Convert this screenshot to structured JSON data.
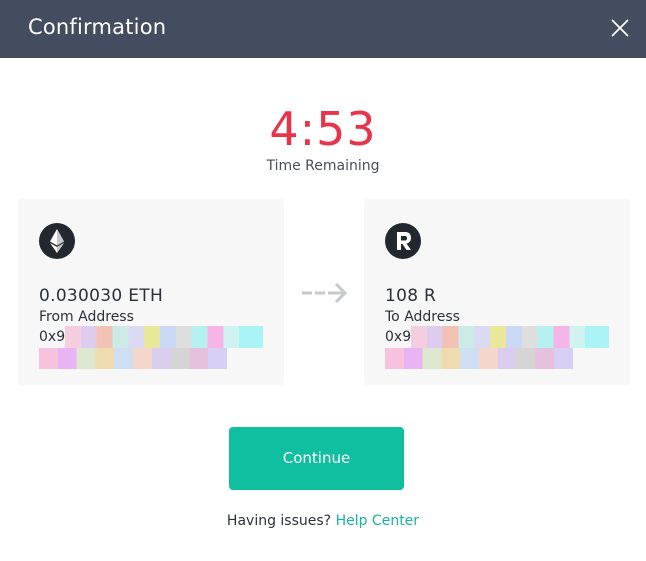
{
  "header": {
    "title": "Confirmation",
    "close_icon": "close-icon"
  },
  "timer": {
    "value": "4:53",
    "label": "Time Remaining",
    "color": "#e8344a"
  },
  "from": {
    "icon": "ethereum-icon",
    "amount": "0.030030 ETH",
    "address_label": "From Address",
    "address_prefix": "0x9"
  },
  "to": {
    "icon": "rep-token-icon",
    "amount": "108 R",
    "address_label": "To Address",
    "address_prefix": "0x9"
  },
  "transfer_arrow_icon": "dashed-arrow-right-icon",
  "actions": {
    "continue_label": "Continue",
    "continue_color": "#0fbf9f"
  },
  "help": {
    "text": "Having issues?",
    "link_label": "Help Center",
    "link_color": "#17b3a3"
  },
  "colors": {
    "header_bg": "#434d5f",
    "card_bg": "#f7f7f7"
  }
}
